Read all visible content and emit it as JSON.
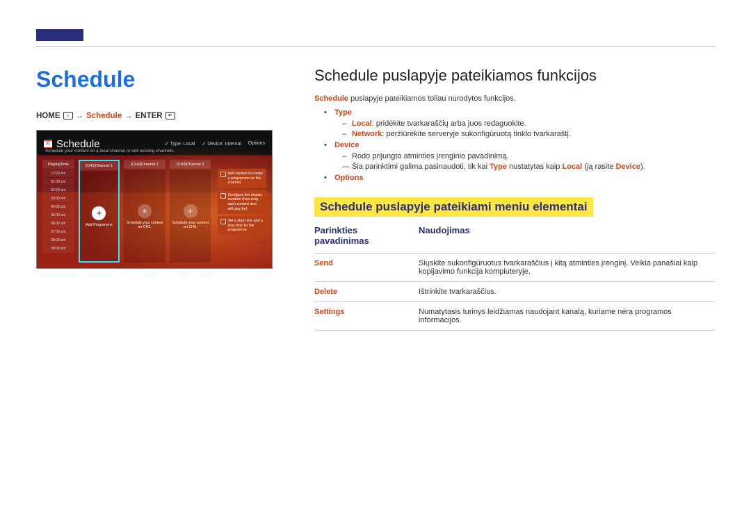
{
  "breadcrumb": {
    "home": "HOME",
    "home_icon": "⌂",
    "schedule": "Schedule",
    "enter": "ENTER",
    "enter_icon": "↵",
    "arrow": "→"
  },
  "left_title": "Schedule",
  "screenshot": {
    "title": "Schedule",
    "subtitle": "Schedule your content on a local channel or edit existing channels.",
    "type_label": "Type: Local",
    "device_label": "Device: Internal",
    "options_label": "Options",
    "times_header": "PlayingTime",
    "times": [
      "12:00 am",
      "01:00 am",
      "02:00 am",
      "03:00 am",
      "04:00 am",
      "05:00 am",
      "06:00 am",
      "07:00 am",
      "08:00 am",
      "09:00 am"
    ],
    "channels": [
      {
        "name": "[CH1]Channel 1",
        "caption": "Add Programme",
        "selected": true
      },
      {
        "name": "[CH2]Channel 2",
        "caption": "Schedule your content on CH2.",
        "selected": false
      },
      {
        "name": "[CH3]Channel 3",
        "caption": "Schedule your content on CH3.",
        "selected": false
      }
    ],
    "tips": [
      "Add content to create a programme on the channel.",
      "Configure the display duration (how long each content item will play for).",
      "Set a start time and a stop time for the programme."
    ]
  },
  "right": {
    "h1": "Schedule puslapyje pateikiamos funkcijos",
    "intro_prefix": "Schedule",
    "intro_rest": " puslapyje pateikiamos toliau nurodytos funkcijos.",
    "type": {
      "label": "Type",
      "local_label": "Local",
      "local_text": ": pridėkite tvarkaraščių arba juos redaguokite.",
      "network_label": "Network",
      "network_text": ": peržiūrėkite serveryje sukonfigūruotą tinklo tvarkaraštį."
    },
    "device": {
      "label": "Device",
      "desc": "Rodo prijungto atminties įrenginio pavadinimą.",
      "note_pre": "Šia parinktimi galima pasinaudoti, tik kai ",
      "note_kw1": "Type",
      "note_mid": " nustatytas kaip ",
      "note_kw2": "Local",
      "note_aft": " (ją rasite ",
      "note_kw3": "Device",
      "note_close": ")."
    },
    "options": {
      "label": "Options"
    },
    "h2": "Schedule puslapyje pateikiami meniu elementai",
    "table": {
      "col1": "Parinkties pavadinimas",
      "col2": "Naudojimas",
      "rows": [
        {
          "name": "Send",
          "desc": "Siųskite sukonfigūruotus tvarkaraščius į kitą atminties įrenginį. Veikia panašiai kaip kopijavimo funkcija kompiuteryje."
        },
        {
          "name": "Delete",
          "desc": "Ištrinkite tvarkaraščius."
        },
        {
          "name": "Settings",
          "desc": "Numatytasis turinys leidžiamas naudojant kanalą, kuriame nėra programos informacijos."
        }
      ]
    }
  }
}
